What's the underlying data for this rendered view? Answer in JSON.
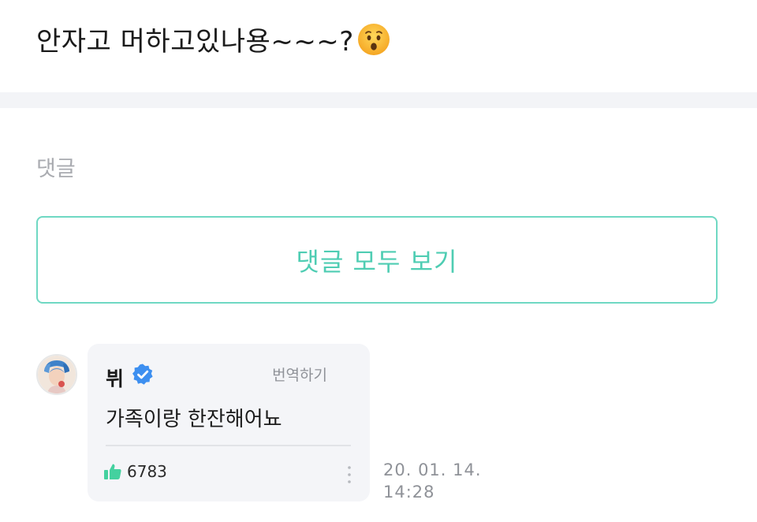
{
  "post": {
    "text": "안자고 머하고있나용~~~?",
    "emoji_icon": "hushed-face-emoji"
  },
  "comments_section": {
    "label": "댓글",
    "view_all_label": "댓글 모두 보기"
  },
  "comment": {
    "author": "뷔",
    "verified_icon": "verified-badge-icon",
    "translate_label": "번역하기",
    "body": "가족이랑 한잔해어뇨",
    "likes": "6783",
    "date": "20. 01. 14.",
    "time": "14:28"
  },
  "colors": {
    "accent": "#4fcdb3",
    "verified": "#3d8ff0",
    "like": "#44d19f"
  }
}
